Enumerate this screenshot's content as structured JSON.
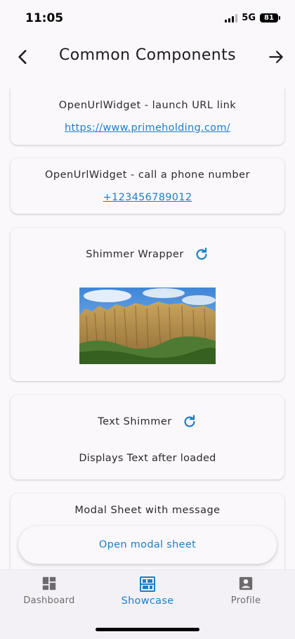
{
  "status_bar": {
    "time": "11:05",
    "network": "5G",
    "battery": "81"
  },
  "app_bar": {
    "title": "Common Components",
    "back_icon": "arrow-back-icon",
    "forward_icon": "arrow-forward-icon"
  },
  "cards": {
    "open_url": {
      "title": "OpenUrlWidget - launch URL link",
      "link": "https://www.primeholding.com/"
    },
    "phone": {
      "title": "OpenUrlWidget - call a phone number",
      "link": "+123456789012"
    },
    "shimmer": {
      "title": "Shimmer Wrapper",
      "icon": "refresh-icon"
    },
    "text_shimmer": {
      "title": "Text Shimmer",
      "icon": "refresh-icon",
      "body": "Displays Text after loaded"
    },
    "modal": {
      "title": "Modal Sheet with message",
      "button": "Open modal sheet"
    }
  },
  "bottom_nav": {
    "items": [
      {
        "label": "Dashboard",
        "icon": "dashboard-icon",
        "active": false
      },
      {
        "label": "Showcase",
        "icon": "showcase-icon",
        "active": true
      },
      {
        "label": "Profile",
        "icon": "profile-icon",
        "active": false
      }
    ]
  },
  "colors": {
    "accent": "#1d7fc4",
    "background": "#fbf8fc",
    "nav_background": "#f4f1f6"
  }
}
